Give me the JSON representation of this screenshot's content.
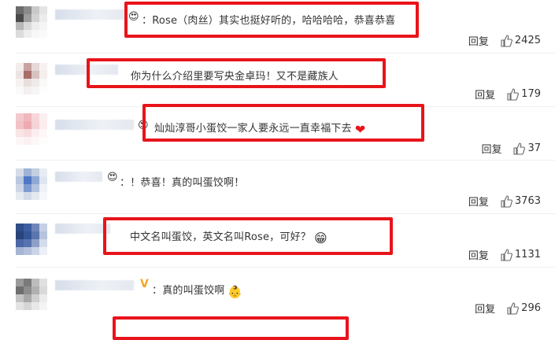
{
  "comments": [
    {
      "text": "：Rose（肉丝）其实也挺好听的，哈哈哈哈，恭喜恭喜",
      "reply": "回复",
      "likes": "2425",
      "emoji": "heart-eyes-emoji"
    },
    {
      "text": "你为什么介绍里要写央金卓玛！又不是藏族人",
      "reply": "回复",
      "likes": "179"
    },
    {
      "text": "灿灿淳哥小蛋饺一家人要永远一直幸福下去",
      "reply": "回复",
      "likes": "37",
      "emoji": "red-heart-emoji"
    },
    {
      "text": "：！恭喜！真的叫蛋饺啊！",
      "reply": "回复",
      "likes": "3763"
    },
    {
      "text": "中文名叫蛋饺，英文名叫Rose，可好？",
      "reply": "回复",
      "likes": "1131",
      "emoji": "grin-emoji"
    },
    {
      "text": "：真的叫蛋饺啊",
      "reply": "回复",
      "likes": "296",
      "emoji": "baby-emoji"
    }
  ],
  "colors": {
    "highlight": "#e8141b",
    "badge": "#f5a623"
  }
}
